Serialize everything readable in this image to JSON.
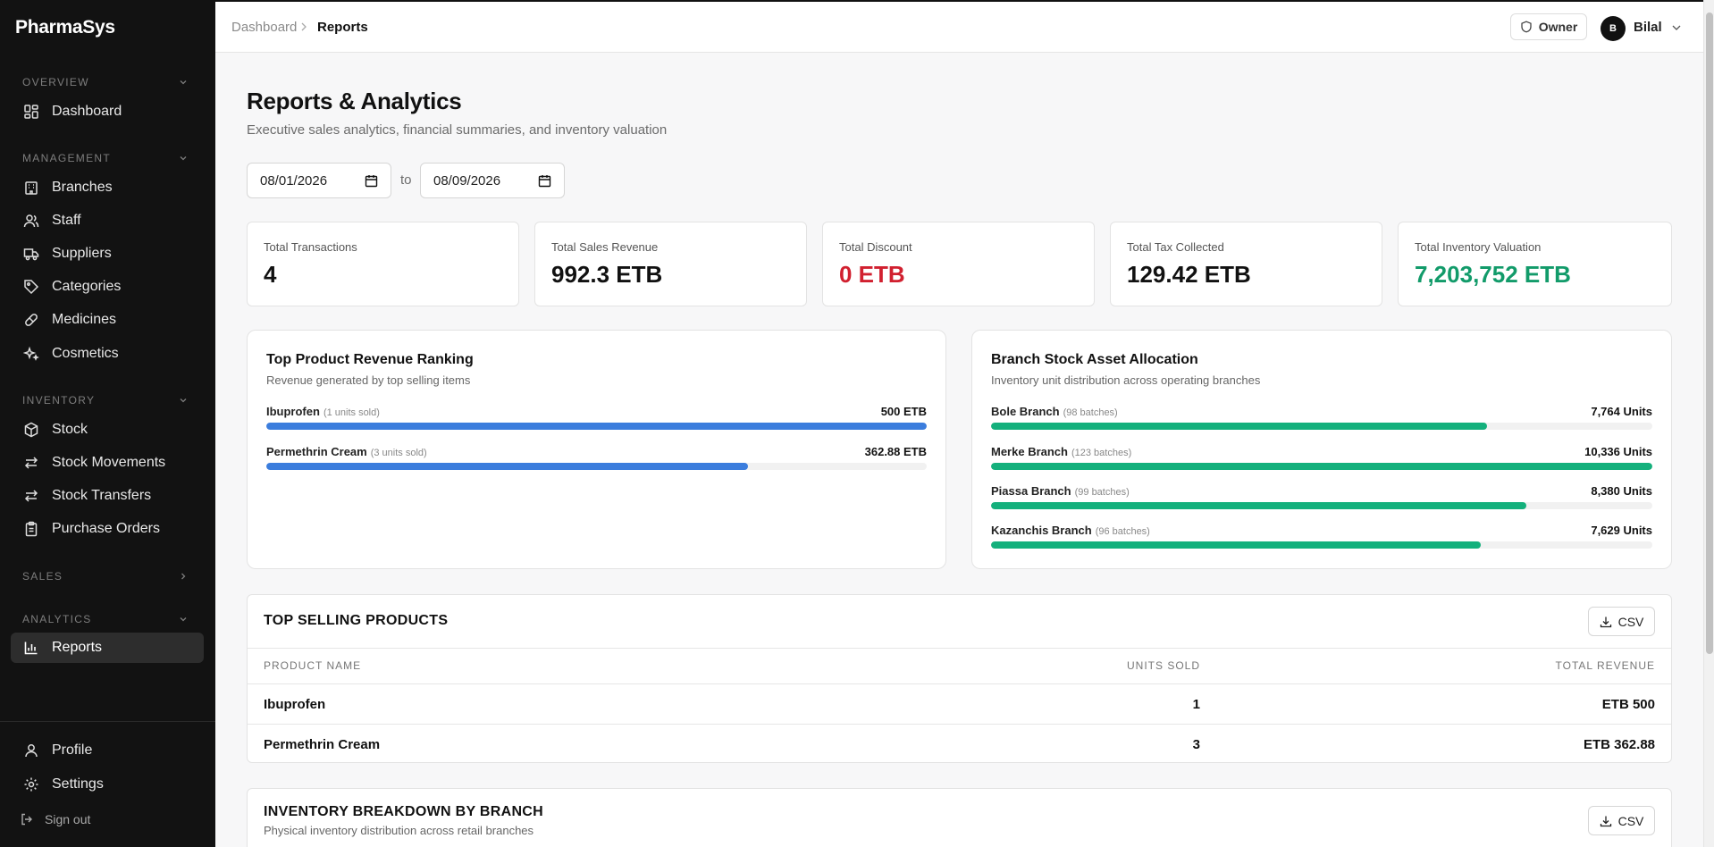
{
  "app": {
    "brand": "PharmaSys"
  },
  "sidebar": {
    "sections": {
      "overview": "OVERVIEW",
      "management": "MANAGEMENT",
      "inventory": "INVENTORY",
      "sales": "SALES",
      "analytics": "ANALYTICS"
    },
    "items": {
      "dashboard": "Dashboard",
      "branches": "Branches",
      "staff": "Staff",
      "suppliers": "Suppliers",
      "categories": "Categories",
      "medicines": "Medicines",
      "cosmetics": "Cosmetics",
      "stock": "Stock",
      "stock_movements": "Stock Movements",
      "stock_transfers": "Stock Transfers",
      "purchase_orders": "Purchase Orders",
      "reports": "Reports"
    },
    "footer": {
      "profile": "Profile",
      "settings": "Settings",
      "signout": "Sign out"
    }
  },
  "topbar": {
    "breadcrumb": [
      "Dashboard",
      "Reports"
    ],
    "role": "Owner",
    "user_initial": "B",
    "user_name": "Bilal"
  },
  "page": {
    "title": "Reports & Analytics",
    "subtitle": "Executive sales analytics, financial summaries, and inventory valuation",
    "date_from": "08/01/2026",
    "date_to_label": "to",
    "date_to": "08/09/2026"
  },
  "stats": [
    {
      "label": "Total Transactions",
      "value": "4",
      "color": "#111111"
    },
    {
      "label": "Total Sales Revenue",
      "value": "992.3 ETB",
      "color": "#111111"
    },
    {
      "label": "Total Discount",
      "value": "0 ETB",
      "color": "#d1202f"
    },
    {
      "label": "Total Tax Collected",
      "value": "129.42 ETB",
      "color": "#111111"
    },
    {
      "label": "Total Inventory Valuation",
      "value": "7,203,752 ETB",
      "color": "#129b6a"
    }
  ],
  "top_products_panel": {
    "title": "Top Product Revenue Ranking",
    "subtitle": "Revenue generated by top selling items",
    "bar_color": "#3b7ddd",
    "rows": [
      {
        "name": "Ibuprofen",
        "meta": "(1 units sold)",
        "value": "500 ETB",
        "fraction": 1.0
      },
      {
        "name": "Permethrin Cream",
        "meta": "(3 units sold)",
        "value": "362.88 ETB",
        "fraction": 0.73
      }
    ]
  },
  "branch_panel": {
    "title": "Branch Stock Asset Allocation",
    "subtitle": "Inventory unit distribution across operating branches",
    "bar_color": "#14b07c",
    "rows": [
      {
        "name": "Bole Branch",
        "meta": "(98 batches)",
        "value": "7,764 Units",
        "fraction": 0.75
      },
      {
        "name": "Merke Branch",
        "meta": "(123 batches)",
        "value": "10,336 Units",
        "fraction": 1.0
      },
      {
        "name": "Piassa Branch",
        "meta": "(99 batches)",
        "value": "8,380 Units",
        "fraction": 0.81
      },
      {
        "name": "Kazanchis Branch",
        "meta": "(96 batches)",
        "value": "7,629 Units",
        "fraction": 0.74
      }
    ]
  },
  "top_selling": {
    "title": "TOP SELLING PRODUCTS",
    "csv_label": "CSV",
    "columns": [
      "PRODUCT NAME",
      "UNITS SOLD",
      "TOTAL REVENUE"
    ],
    "rows": [
      [
        "Ibuprofen",
        "1",
        "ETB 500"
      ],
      [
        "Permethrin Cream",
        "3",
        "ETB 362.88"
      ]
    ]
  },
  "inventory_breakdown": {
    "title": "INVENTORY BREAKDOWN BY BRANCH",
    "subtitle": "Physical inventory distribution across retail branches",
    "csv_label": "CSV"
  }
}
